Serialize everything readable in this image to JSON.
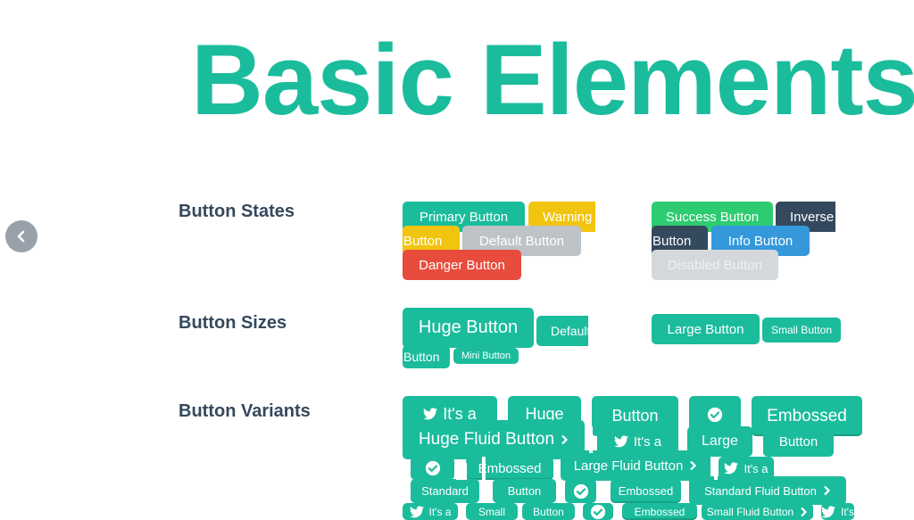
{
  "page": {
    "title": "Basic Elements"
  },
  "nav": {
    "back_icon": "chevron-left-icon"
  },
  "colors": {
    "primary": "#1abc9c",
    "warning": "#f1c40f",
    "default": "#bdc3c7",
    "danger": "#e74c3c",
    "success": "#2ecc71",
    "inverse": "#34495e",
    "info": "#3498db",
    "disabled": "#d5d8db",
    "heading": "#34495e"
  },
  "sections": [
    {
      "label": "Button States"
    },
    {
      "label": "Button Sizes"
    },
    {
      "label": "Button Variants"
    }
  ],
  "buttons": [
    {
      "label": "Primary Button",
      "color": "primary"
    },
    {
      "label": "Warning",
      "color": "warning"
    },
    {
      "label": "Button",
      "color": "warning"
    },
    {
      "label": "Default Button",
      "color": "default"
    },
    {
      "label": "Danger Button",
      "color": "danger"
    },
    {
      "label": "Success Button",
      "color": "success"
    },
    {
      "label": "Inverse",
      "color": "inverse"
    },
    {
      "label": "Button",
      "color": "inverse"
    },
    {
      "label": "Info Button",
      "color": "info"
    },
    {
      "label": "Disabled Button",
      "color": "disabled",
      "disabled": true
    },
    {
      "label": "Huge Button",
      "color": "primary"
    },
    {
      "label": "Default",
      "color": "primary"
    },
    {
      "label": "Button",
      "color": "primary"
    },
    {
      "label": "Mini Button",
      "color": "primary"
    },
    {
      "label": "Large Button",
      "color": "primary"
    },
    {
      "label": "Small Button",
      "color": "primary"
    },
    {
      "label": "It's a",
      "color": "primary",
      "icon": "twitter-icon"
    },
    {
      "label": "Huge",
      "color": "primary"
    },
    {
      "label": "Button",
      "color": "primary"
    },
    {
      "label": "",
      "color": "primary",
      "icon": "check-circle-icon"
    },
    {
      "label": "Embossed",
      "color": "primary",
      "embossed": true
    },
    {
      "label": "Huge Fluid Button",
      "color": "primary",
      "icon_after": "chevron-right-icon"
    },
    {
      "label": "It's a",
      "color": "primary",
      "icon": "twitter-icon"
    },
    {
      "label": "Large",
      "color": "primary"
    },
    {
      "label": "Button",
      "color": "primary"
    },
    {
      "label": "",
      "color": "primary",
      "icon": "check-circle-icon"
    },
    {
      "label": "Embossed",
      "color": "primary",
      "embossed": true
    },
    {
      "label": "Large Fluid Button",
      "color": "primary",
      "icon_after": "chevron-right-icon"
    },
    {
      "label": "It's a",
      "color": "primary",
      "icon": "twitter-icon"
    },
    {
      "label": "Standard",
      "color": "primary"
    },
    {
      "label": "Button",
      "color": "primary"
    },
    {
      "label": "",
      "color": "primary",
      "icon": "check-circle-icon"
    },
    {
      "label": "Embossed",
      "color": "primary",
      "embossed": true
    },
    {
      "label": "Standard Fluid Button",
      "color": "primary",
      "icon_after": "chevron-right-icon"
    },
    {
      "label": "It's a",
      "color": "primary",
      "icon": "twitter-icon"
    },
    {
      "label": "Small",
      "color": "primary"
    },
    {
      "label": "Button",
      "color": "primary"
    },
    {
      "label": "",
      "color": "primary",
      "icon": "check-circle-icon"
    },
    {
      "label": "Embossed",
      "color": "primary",
      "embossed": true
    },
    {
      "label": "Small Fluid Button",
      "color": "primary",
      "icon_after": "chevron-right-icon"
    },
    {
      "label": "It's",
      "color": "primary",
      "icon": "twitter-icon"
    }
  ]
}
